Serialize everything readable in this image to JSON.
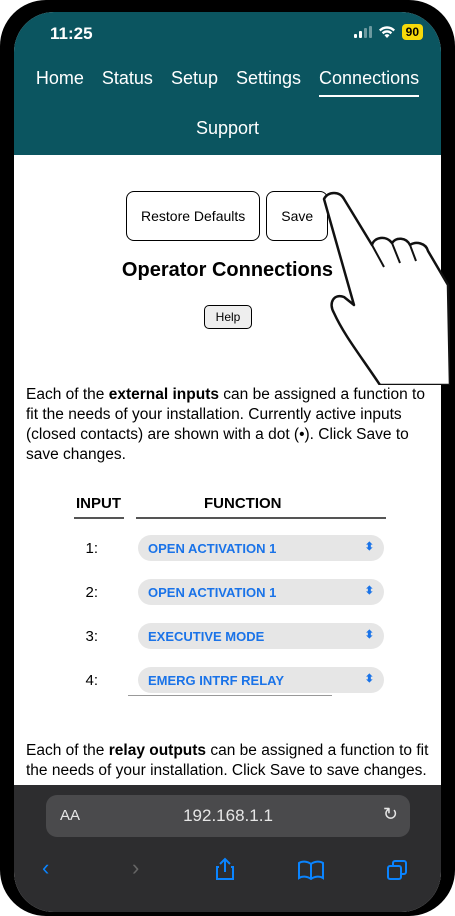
{
  "status": {
    "time": "11:25",
    "battery": "90"
  },
  "nav": {
    "items": [
      "Home",
      "Status",
      "Setup",
      "Settings",
      "Connections"
    ],
    "active": "Connections",
    "second_row": "Support"
  },
  "toolbar": {
    "restore_label": "Restore Defaults",
    "save_label": "Save"
  },
  "page": {
    "title": "Operator Connections",
    "help_label": "Help",
    "intro": {
      "pre": "Each of the ",
      "bold": "external inputs",
      "post": " can be assigned a function to fit the needs of your installation. Currently active inputs (closed contacts) are shown with a dot (•). Click Save to save changes."
    },
    "table": {
      "input_header": "INPUT",
      "function_header": "FUNCTION",
      "rows": [
        {
          "num": "1:",
          "value": "OPEN ACTIVATION 1"
        },
        {
          "num": "2:",
          "value": "OPEN ACTIVATION 1"
        },
        {
          "num": "3:",
          "value": "EXECUTIVE MODE"
        },
        {
          "num": "4:",
          "value": "EMERG INTRF RELAY"
        }
      ]
    },
    "relay": {
      "pre": "Each of the ",
      "bold": "relay outputs",
      "post": " can be assigned a function to fit the needs of your installation. Click Save to save changes."
    }
  },
  "browser": {
    "text_size": "AA",
    "url": "192.168.1.1"
  },
  "colors": {
    "header": "#0b5560",
    "select_text": "#1a73e8",
    "toolbar_icon": "#0a84ff"
  }
}
